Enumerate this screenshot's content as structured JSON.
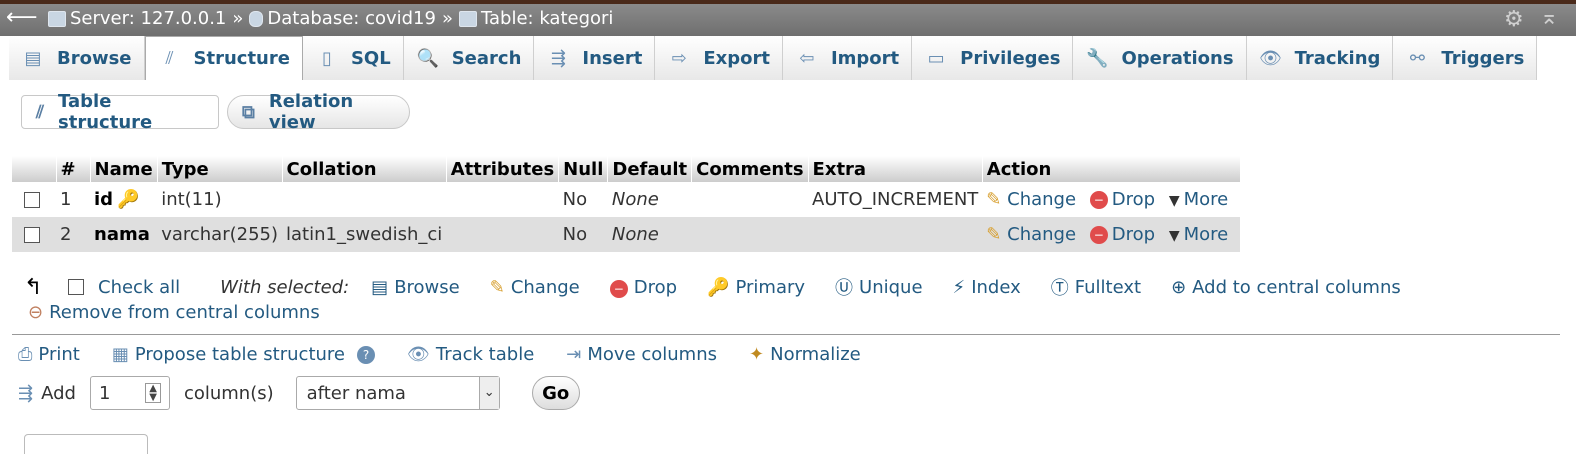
{
  "breadcrumb": {
    "server": "Server: 127.0.0.1",
    "database": "Database: covid19",
    "table": "Table: kategori",
    "separator": "»"
  },
  "tabs": [
    "Browse",
    "Structure",
    "SQL",
    "Search",
    "Insert",
    "Export",
    "Import",
    "Privileges",
    "Operations",
    "Tracking",
    "Triggers"
  ],
  "active_tab": "Structure",
  "subtabs": {
    "table_structure": "Table structure",
    "relation_view": "Relation view"
  },
  "table": {
    "headers": {
      "num": "#",
      "name": "Name",
      "type": "Type",
      "collation": "Collation",
      "attributes": "Attributes",
      "null": "Null",
      "default": "Default",
      "comments": "Comments",
      "extra": "Extra",
      "action": "Action"
    },
    "rows": [
      {
        "num": "1",
        "name": "id",
        "type": "int(11)",
        "collation": "",
        "attributes": "",
        "null": "No",
        "default": "None",
        "comments": "",
        "extra": "AUTO_INCREMENT"
      },
      {
        "num": "2",
        "name": "nama",
        "type": "varchar(255)",
        "collation": "latin1_swedish_ci",
        "attributes": "",
        "null": "No",
        "default": "None",
        "comments": "",
        "extra": ""
      }
    ],
    "actions": {
      "change": "Change",
      "drop": "Drop",
      "more": "More"
    }
  },
  "with_selected": {
    "check_all": "Check all",
    "label": "With selected:",
    "browse": "Browse",
    "change": "Change",
    "drop": "Drop",
    "primary": "Primary",
    "unique": "Unique",
    "index": "Index",
    "fulltext": "Fulltext",
    "add_central": "Add to central columns",
    "remove_central": "Remove from central columns"
  },
  "tools": {
    "print": "Print",
    "propose": "Propose table structure",
    "track": "Track table",
    "move": "Move columns",
    "normalize": "Normalize"
  },
  "add_column": {
    "label": "Add",
    "count": "1",
    "suffix": "column(s)",
    "position": "after nama",
    "go": "Go"
  }
}
